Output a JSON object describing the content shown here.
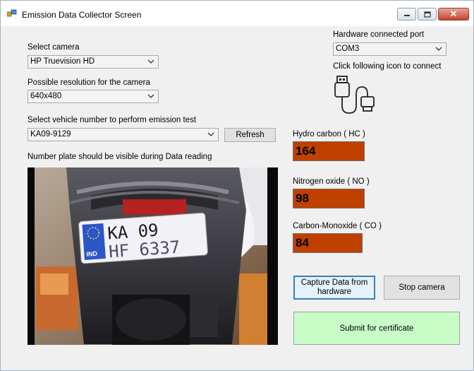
{
  "window": {
    "title": "Emission Data Collector Screen",
    "buttons": {
      "close": "✕"
    }
  },
  "camera_select": {
    "label": "Select camera",
    "value": "HP Truevision HD"
  },
  "resolution": {
    "label": "Possible resolution for the camera",
    "value": "640x480"
  },
  "vehicle": {
    "label": "Select vehicle number to perform emission test",
    "value": "KA09-9129",
    "refresh_label": "Refresh"
  },
  "preview": {
    "label": "Number plate should be visible during  Data reading",
    "plate_line1": "KA 09",
    "plate_line2": "HF 6337",
    "plate_country": "IND"
  },
  "hardware": {
    "label": "Hardware connected port",
    "port": "COM3",
    "connect_hint": "Click following icon to connect",
    "icon": "usb-cable-icon"
  },
  "readings": {
    "hc_label": "Hydro carbon ( HC )",
    "hc_value": "164",
    "no_label": "Nitrogen oxide ( NO )",
    "no_value": "98",
    "co_label": "Carbon-Monoxide ( CO )",
    "co_value": "84"
  },
  "actions": {
    "capture_label": "Capture Data from hardware",
    "stop_label": "Stop camera",
    "submit_label": "Submit for certificate"
  },
  "colors": {
    "reading_bg": "#c04000",
    "submit_bg": "#c8fdc8",
    "focus_border": "#3c7fb1"
  }
}
